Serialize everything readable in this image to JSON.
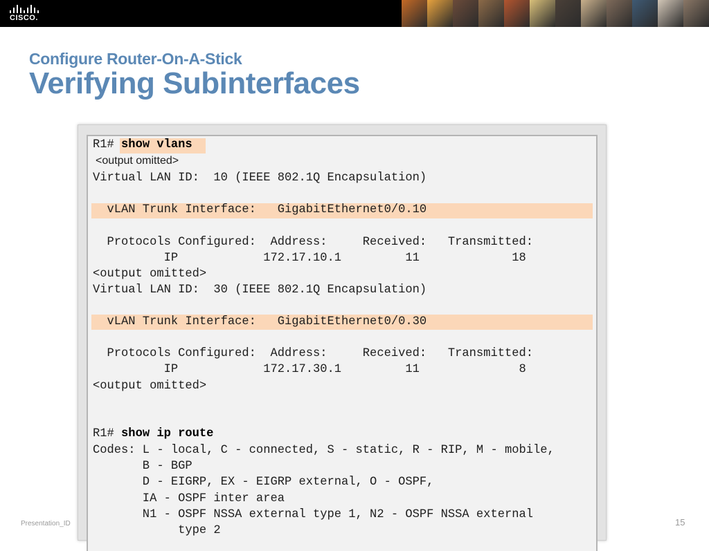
{
  "header": {
    "logo_text": "CISCO.",
    "photo_colors": [
      "#c46a26",
      "#e7a23e",
      "#6b4b3a",
      "#8c6a48",
      "#b3552f",
      "#d9c07a",
      "#4a4038",
      "#c9b08c",
      "#7e6a5a",
      "#3f5a74",
      "#d2c6b7",
      "#8a7766"
    ]
  },
  "slide": {
    "subtitle": "Configure Router-On-A-Stick",
    "title": "Verifying Subinterfaces",
    "footer_id": "Presentation_ID",
    "page_number": "15"
  },
  "terminal": {
    "cmd1_prompt": "R1# ",
    "cmd1": "show vlans",
    "omitted_a": "<output omitted>",
    "vlan10_header": "Virtual LAN ID:  10 (IEEE 802.1Q Encapsulation)",
    "vlan10_trunk": "  vLAN Trunk Interface:   GigabitEthernet0/0.10",
    "vlan10_proto_header": "  Protocols Configured:  Address:     Received:   Transmitted:",
    "vlan10_proto_row": "          IP            172.17.10.1         11             18",
    "omitted_b": "<output omitted>",
    "vlan30_header": "Virtual LAN ID:  30 (IEEE 802.1Q Encapsulation)",
    "vlan30_trunk": "  vLAN Trunk Interface:   GigabitEthernet0/0.30",
    "vlan30_proto_header": "  Protocols Configured:  Address:     Received:   Transmitted:",
    "vlan30_proto_row": "          IP            172.17.30.1         11              8",
    "omitted_c": "<output omitted>",
    "cmd2_prompt": "R1# ",
    "cmd2": "show ip route",
    "codes1": "Codes: L - local, C - connected, S - static, R - RIP, M - mobile,",
    "codes2": "       B - BGP",
    "codes3": "       D - EIGRP, EX - EIGRP external, O - OSPF,",
    "codes4": "       IA - OSPF inter area",
    "codes5": "       N1 - OSPF NSSA external type 1, N2 - OSPF NSSA external",
    "codes6": "            type 2"
  }
}
